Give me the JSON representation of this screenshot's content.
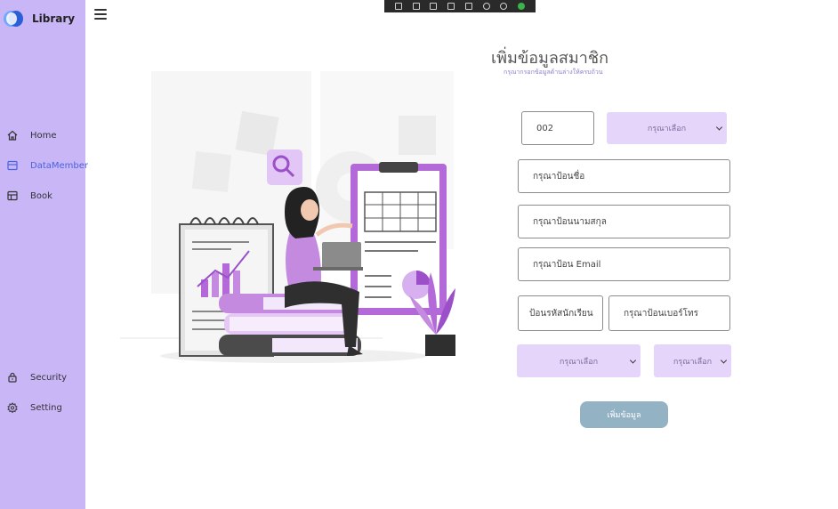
{
  "brand": {
    "label": "Library"
  },
  "sidebar": {
    "items": [
      {
        "label": "Home",
        "icon": "home-icon"
      },
      {
        "label": "DataMember",
        "icon": "member-icon",
        "active": true
      },
      {
        "label": "Book",
        "icon": "book-icon"
      },
      {
        "label": "Security",
        "icon": "lock-icon"
      },
      {
        "label": "Setting",
        "icon": "gear-icon"
      }
    ]
  },
  "header": {
    "title": "เพิ่มข้อมูลสมาชิก",
    "subtitle": "กรุณากรอกข้อมูลด้านล่างให้ครบถ้วน"
  },
  "form": {
    "member_id_value": "002",
    "select_top_label": "กรุณาเลือก",
    "name_placeholder": "กรุณาป้อนชื่อ",
    "surname_placeholder": "กรุณาป้อนนามสกุล",
    "email_placeholder": "กรุณาป้อน Email",
    "student_id_placeholder": "ป้อนรหัสนักเรียน",
    "phone_placeholder": "กรุณาป้อนเบอร์โทร",
    "select_bottom_left_label": "กรุณาเลือก",
    "select_bottom_right_label": "กรุณาเลือก",
    "submit_label": "เพิ่มข้อมูล"
  },
  "colors": {
    "sidebar_bg": "#c9b6f7",
    "select_bg": "#e6d5fb",
    "submit_bg": "#93b2c4",
    "accent_purple": "#b36ad8",
    "active_nav": "#4a63e0"
  }
}
